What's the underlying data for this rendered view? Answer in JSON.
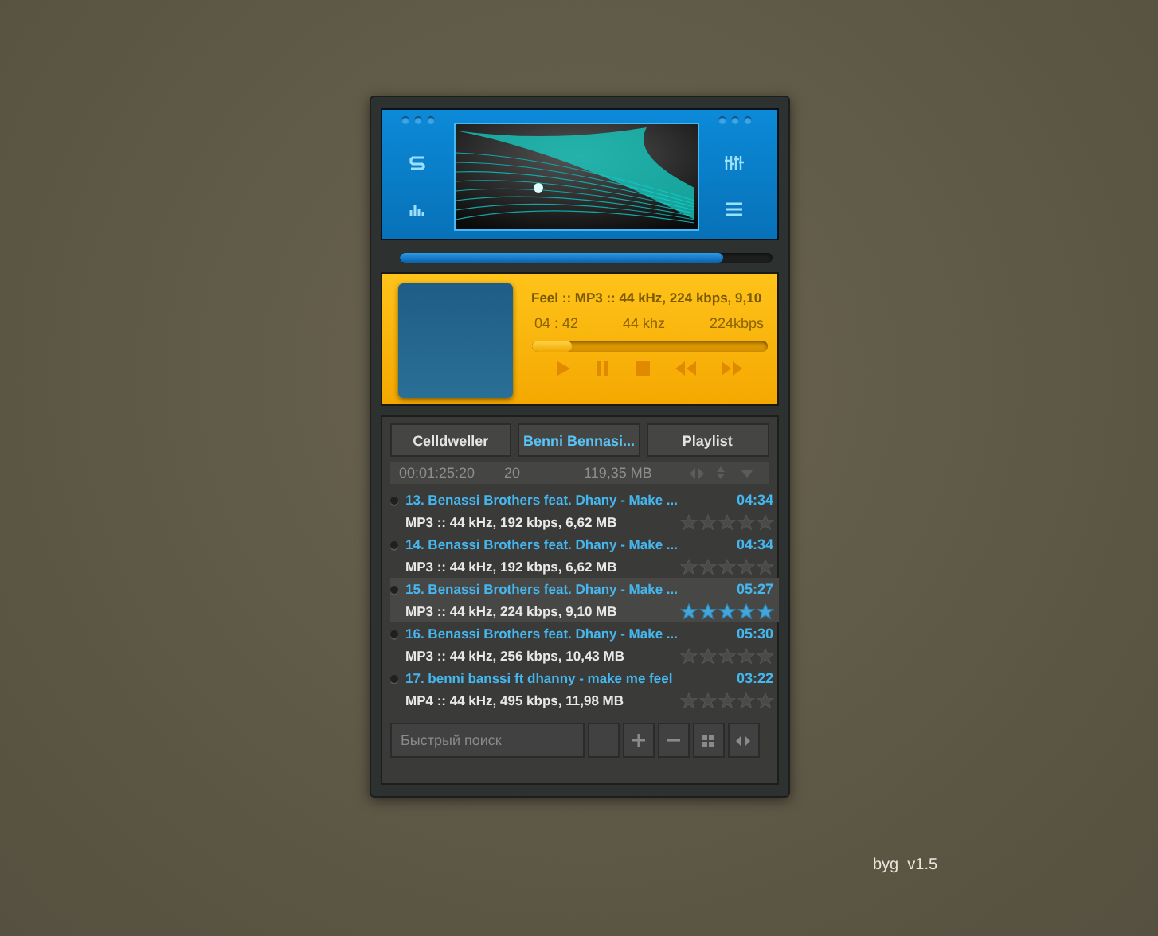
{
  "visualizer": {
    "progress": {
      "level": 0.87
    }
  },
  "now_playing": {
    "scroll_title": "Feel :: MP3 :: 44 kHz, 224 kbps, 9,10",
    "time": "04 : 42",
    "sample_rate": "44 khz",
    "bitrate": "224kbps",
    "position": {
      "level": 0.17
    }
  },
  "tabs": [
    {
      "label": "Celldweller",
      "selected": false
    },
    {
      "label": "Benni Bennasi...",
      "selected": true
    },
    {
      "label": "Playlist",
      "selected": false
    }
  ],
  "summary": {
    "total_time": "00:01:25:20",
    "count": "20",
    "size": "119,35 MB"
  },
  "tracks": [
    {
      "title": "13. Benassi Brothers feat. Dhany - Make ...",
      "duration": "04:34",
      "info": "MP3 :: 44 kHz, 192 kbps, 6,62 MB",
      "stars": 0,
      "selected": false
    },
    {
      "title": "14. Benassi Brothers feat. Dhany - Make ...",
      "duration": "04:34",
      "info": "MP3 :: 44 kHz, 192 kbps, 6,62 MB",
      "stars": 0,
      "selected": false
    },
    {
      "title": "15. Benassi Brothers feat. Dhany - Make ...",
      "duration": "05:27",
      "info": "MP3 :: 44 kHz, 224 kbps, 9,10 MB",
      "stars": 5,
      "selected": true
    },
    {
      "title": "16. Benassi Brothers feat. Dhany - Make ...",
      "duration": "05:30",
      "info": "MP3 :: 44 kHz, 256 kbps, 10,43 MB",
      "stars": 0,
      "selected": false
    },
    {
      "title": "17. benni banssi ft dhanny - make me feel",
      "duration": "03:22",
      "info": "MP4 :: 44 kHz, 495 kbps, 11,98 MB",
      "stars": 0,
      "selected": false
    }
  ],
  "search": {
    "placeholder": "Быстрый поиск"
  },
  "version": "byg  v1.5"
}
